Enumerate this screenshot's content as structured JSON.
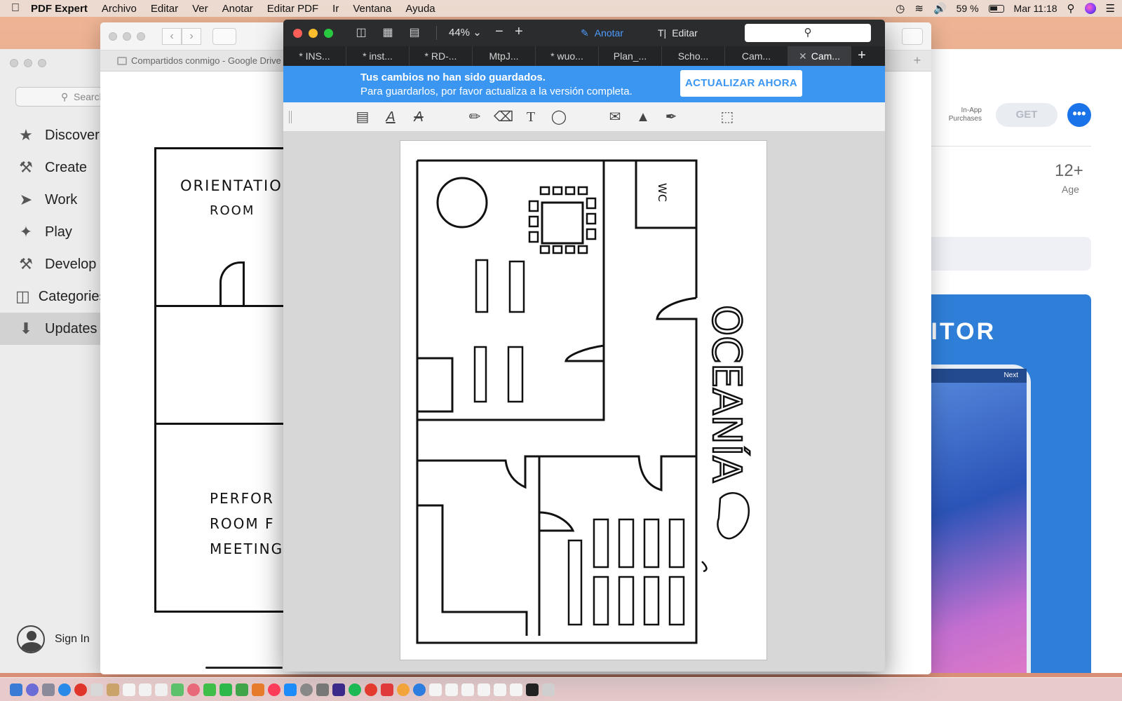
{
  "menubar": {
    "app_name": "PDF Expert",
    "items": [
      "Archivo",
      "Editar",
      "Ver",
      "Anotar",
      "Editar PDF",
      "Ir",
      "Ventana",
      "Ayuda"
    ],
    "battery": "59 %",
    "clock": "Mar 11:18"
  },
  "app_store": {
    "search_placeholder": "Search",
    "nav": [
      {
        "label": "Discover",
        "icon": "star-icon"
      },
      {
        "label": "Create",
        "icon": "hammer-brush-icon"
      },
      {
        "label": "Work",
        "icon": "paper-plane-icon"
      },
      {
        "label": "Play",
        "icon": "rocket-icon"
      },
      {
        "label": "Develop",
        "icon": "hammer-icon"
      },
      {
        "label": "Categories",
        "icon": "stack-icon"
      },
      {
        "label": "Updates",
        "icon": "download-icon"
      }
    ],
    "active_nav": "Updates",
    "sign_in": "Sign In",
    "in_app": "In-App\nPurchases",
    "get": "GET",
    "age_value": "12+",
    "age_label": "Age",
    "promo_title": "DITOR",
    "promo_next": "Next"
  },
  "browser": {
    "tab_title": "Compartidos conmigo - Google Drive",
    "sketch": {
      "label1": "ORIENTATION",
      "label2": "ROOM",
      "label3": "PERFOR\nROOM F\nMEETING"
    }
  },
  "pdf_expert": {
    "zoom": "44%",
    "mode_annotate": "Anotar",
    "mode_edit": "Editar",
    "tabs": [
      "* INS...",
      "* inst...",
      "* RD-...",
      "MtpJ...",
      "* wuo...",
      "Plan_...",
      "Scho...",
      "Cam...",
      "Cam..."
    ],
    "active_tab": 8,
    "banner": {
      "title": "Tus cambios no han sido guardados.",
      "subtitle": "Para guardarlos, por favor actualiza a la versión completa.",
      "button": "ACTUALIZAR AHORA"
    },
    "page": {
      "label_wc": "WC",
      "label_oceania": "OCEANÍA"
    }
  },
  "colors": {
    "accent_blue": "#3b96f2",
    "toolbar_dark": "#2b2c2e",
    "app_store_blue": "#1a73e8"
  }
}
